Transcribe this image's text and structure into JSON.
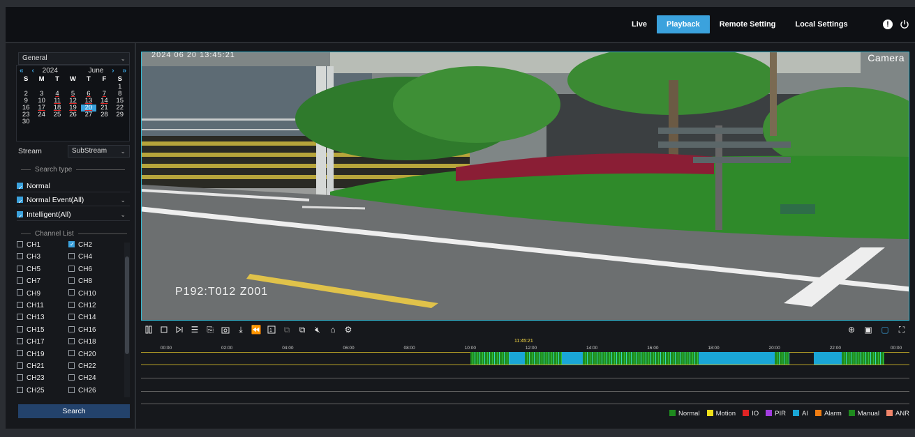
{
  "nav": {
    "tabs": [
      {
        "label": "Live",
        "active": false
      },
      {
        "label": "Playback",
        "active": true
      },
      {
        "label": "Remote Setting",
        "active": false
      },
      {
        "label": "Local Settings",
        "active": false
      }
    ],
    "accent": "#3ba2dd"
  },
  "sidebar": {
    "mode_select": "General",
    "calendar": {
      "year": "2024",
      "month": "June",
      "weekdays": [
        "S",
        "M",
        "T",
        "W",
        "T",
        "F",
        "S"
      ],
      "days": [
        "",
        "",
        "",
        "",
        "",
        "",
        "1",
        "2",
        "3",
        "4",
        "5",
        "6",
        "7",
        "8",
        "9",
        "10",
        "11",
        "12",
        "13",
        "14",
        "15",
        "16",
        "17",
        "18",
        "19",
        "20",
        "21",
        "22",
        "23",
        "24",
        "25",
        "26",
        "27",
        "28",
        "29",
        "30"
      ],
      "recorded_days": [
        "4",
        "5",
        "6",
        "7",
        "11",
        "12",
        "13",
        "14",
        "17",
        "18",
        "19",
        "20"
      ],
      "selected_day": "20"
    },
    "stream_label": "Stream",
    "stream_value": "SubStream",
    "search_type_title": "Search type",
    "search_types": [
      {
        "label": "Normal",
        "checked": true,
        "dropdown": false
      },
      {
        "label": "Normal Event(All)",
        "checked": true,
        "dropdown": true
      },
      {
        "label": "Intelligent(All)",
        "checked": true,
        "dropdown": true
      }
    ],
    "channel_list_title": "Channel List",
    "channels": [
      {
        "label": "CH1",
        "checked": false
      },
      {
        "label": "CH2",
        "checked": true
      },
      {
        "label": "CH3",
        "checked": false
      },
      {
        "label": "CH4",
        "checked": false
      },
      {
        "label": "CH5",
        "checked": false
      },
      {
        "label": "CH6",
        "checked": false
      },
      {
        "label": "CH7",
        "checked": false
      },
      {
        "label": "CH8",
        "checked": false
      },
      {
        "label": "CH9",
        "checked": false
      },
      {
        "label": "CH10",
        "checked": false
      },
      {
        "label": "CH11",
        "checked": false
      },
      {
        "label": "CH12",
        "checked": false
      },
      {
        "label": "CH13",
        "checked": false
      },
      {
        "label": "CH14",
        "checked": false
      },
      {
        "label": "CH15",
        "checked": false
      },
      {
        "label": "CH16",
        "checked": false
      },
      {
        "label": "CH17",
        "checked": false
      },
      {
        "label": "CH18",
        "checked": false
      },
      {
        "label": "CH19",
        "checked": false
      },
      {
        "label": "CH20",
        "checked": false
      },
      {
        "label": "CH21",
        "checked": false
      },
      {
        "label": "CH22",
        "checked": false
      },
      {
        "label": "CH23",
        "checked": false
      },
      {
        "label": "CH24",
        "checked": false
      },
      {
        "label": "CH25",
        "checked": false
      },
      {
        "label": "CH26",
        "checked": false
      }
    ],
    "search_button": "Search"
  },
  "video": {
    "osd_top": "2024 06 20 13:45:21",
    "osd_camera": "Camera",
    "osd_ptz": "P192:T012  Z001"
  },
  "timeline": {
    "ticks": [
      "00:00",
      "02:00",
      "04:00",
      "06:00",
      "08:00",
      "10:00",
      "12:00",
      "14:00",
      "16:00",
      "18:00",
      "20:00",
      "22:00",
      "00:00"
    ],
    "current_time": "11:45:21",
    "current_time_hours": 11.756,
    "segments": [
      {
        "start": 10.0,
        "end": 11.3,
        "type": "normal"
      },
      {
        "start": 11.3,
        "end": 11.8,
        "type": "ai"
      },
      {
        "start": 11.8,
        "end": 13.0,
        "type": "normal"
      },
      {
        "start": 13.0,
        "end": 13.7,
        "type": "ai"
      },
      {
        "start": 13.7,
        "end": 17.5,
        "type": "normal"
      },
      {
        "start": 17.5,
        "end": 20.0,
        "type": "ai"
      },
      {
        "start": 20.0,
        "end": 20.5,
        "type": "normal"
      },
      {
        "start": 21.3,
        "end": 22.2,
        "type": "ai"
      },
      {
        "start": 22.2,
        "end": 23.6,
        "type": "normal"
      }
    ]
  },
  "legend": [
    {
      "label": "Normal",
      "color": "#1e8a1e"
    },
    {
      "label": "Motion",
      "color": "#f0e01a"
    },
    {
      "label": "IO",
      "color": "#e02424"
    },
    {
      "label": "PIR",
      "color": "#a23de0"
    },
    {
      "label": "AI",
      "color": "#1aa6d6"
    },
    {
      "label": "Alarm",
      "color": "#f07d12"
    },
    {
      "label": "Manual",
      "color": "#1e8a1e"
    },
    {
      "label": "ANR",
      "color": "#f0856a"
    }
  ]
}
